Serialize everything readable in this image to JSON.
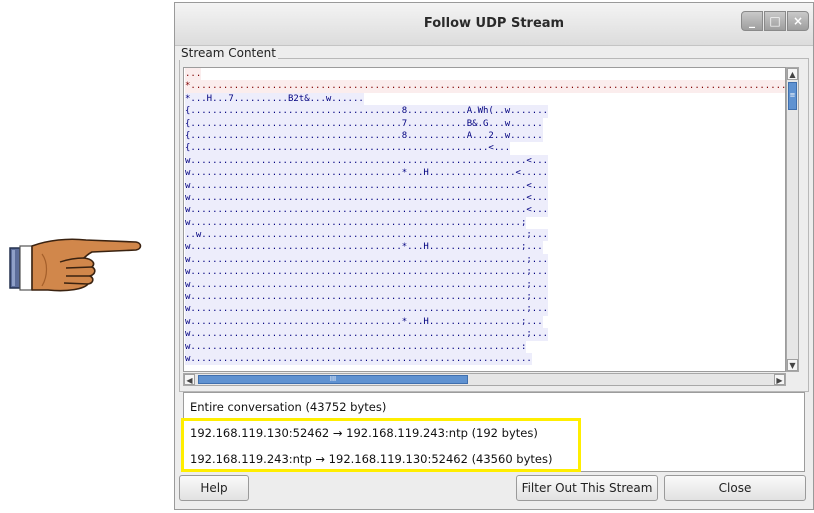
{
  "window": {
    "title": "Follow UDP Stream",
    "controls": {
      "minimize": "_",
      "maximize": "□",
      "close": "×"
    }
  },
  "stream_content": {
    "legend": "Stream Content",
    "lines": [
      {
        "dir": "client",
        "text": "..."
      },
      {
        "dir": "client",
        "text": "*..................................................................................................................."
      },
      {
        "dir": "server",
        "text": "*...H...7..........B2t&...w......"
      },
      {
        "dir": "server",
        "text": "{.......................................8...........A.Wh(..w......."
      },
      {
        "dir": "server",
        "text": "{.......................................7...........B&.G...w......"
      },
      {
        "dir": "server",
        "text": "{.......................................8...........A...2..w......"
      },
      {
        "dir": "server",
        "text": "{.......................................................<..."
      },
      {
        "dir": "server",
        "text": "w..............................................................<..."
      },
      {
        "dir": "server",
        "text": "w.......................................*...H................<....."
      },
      {
        "dir": "server",
        "text": "w..............................................................<..."
      },
      {
        "dir": "server",
        "text": "w..............................................................<..."
      },
      {
        "dir": "server",
        "text": "w..............................................................<..."
      },
      {
        "dir": "server",
        "text": "w.............................................................;"
      },
      {
        "dir": "server",
        "text": "..w............................................................;..."
      },
      {
        "dir": "server",
        "text": "w.......................................*...H.................;..."
      },
      {
        "dir": "server",
        "text": "w..............................................................;..."
      },
      {
        "dir": "server",
        "text": "w..............................................................;..."
      },
      {
        "dir": "server",
        "text": "w..............................................................;..."
      },
      {
        "dir": "server",
        "text": "w..............................................................;..."
      },
      {
        "dir": "server",
        "text": "w..............................................................;..."
      },
      {
        "dir": "server",
        "text": "w.......................................*...H.................;..."
      },
      {
        "dir": "server",
        "text": "w..............................................................;..."
      },
      {
        "dir": "server",
        "text": "w.............................................................:"
      },
      {
        "dir": "server",
        "text": "w..............................................................."
      }
    ]
  },
  "scrollbars": {
    "vertical": {
      "up_arrow": "▲",
      "down_arrow": "▼",
      "thumb_grip": "≡"
    },
    "horizontal": {
      "left_arrow": "◀",
      "right_arrow": "▶",
      "thumb_grip": "III"
    }
  },
  "conversation_options": [
    "Entire conversation (43752 bytes)",
    "192.168.119.130:52462 → 192.168.119.243:ntp (192 bytes)",
    "192.168.119.243:ntp → 192.168.119.130:52462 (43560 bytes)"
  ],
  "buttons": {
    "help": "Help",
    "filter_out": "Filter Out This Stream",
    "close": "Close"
  },
  "colors": {
    "client_text": "#7f0000",
    "client_bg": "#fbeded",
    "server_text": "#00007f",
    "server_bg": "#ededfb",
    "highlight_box": "#ffee00",
    "scroll_thumb": "#5f92d1"
  },
  "annotation": {
    "pointer_icon": "pointing-hand-icon"
  }
}
